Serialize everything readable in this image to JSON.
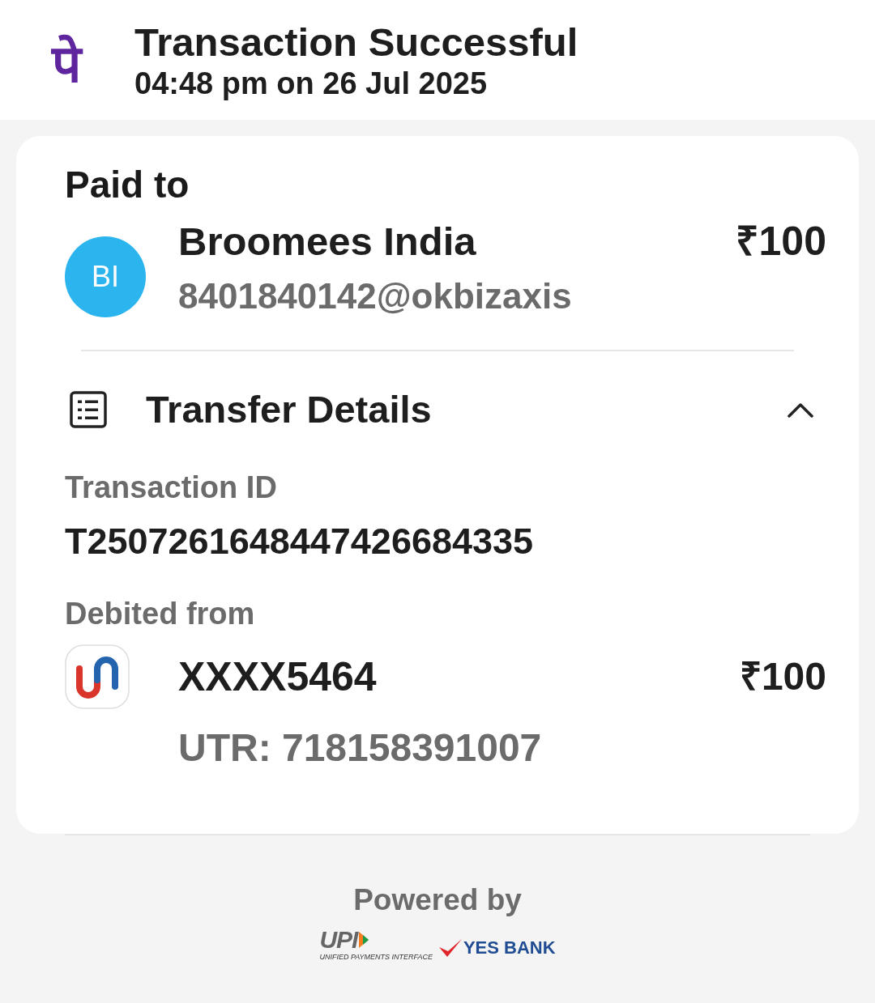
{
  "header": {
    "logo": "पे",
    "title": "Transaction Successful",
    "datetime": "04:48 pm on 26 Jul 2025"
  },
  "paid_to": {
    "heading": "Paid to",
    "avatar_initials": "BI",
    "name": "Broomees India",
    "vpa": "8401840142@okbizaxis",
    "amount": "₹100"
  },
  "transfer_details": {
    "title": "Transfer Details",
    "expanded": true,
    "transaction_id_label": "Transaction ID",
    "transaction_id": "T2507261648447426684335",
    "debited_from_label": "Debited from",
    "account": "XXXX5464",
    "amount": "₹100",
    "utr": "UTR: 718158391007"
  },
  "footer": {
    "powered_by": "Powered by",
    "upi_logo": "UPI",
    "upi_caption": "UNIFIED PAYMENTS INTERFACE",
    "bank_logo": "YES BANK"
  }
}
